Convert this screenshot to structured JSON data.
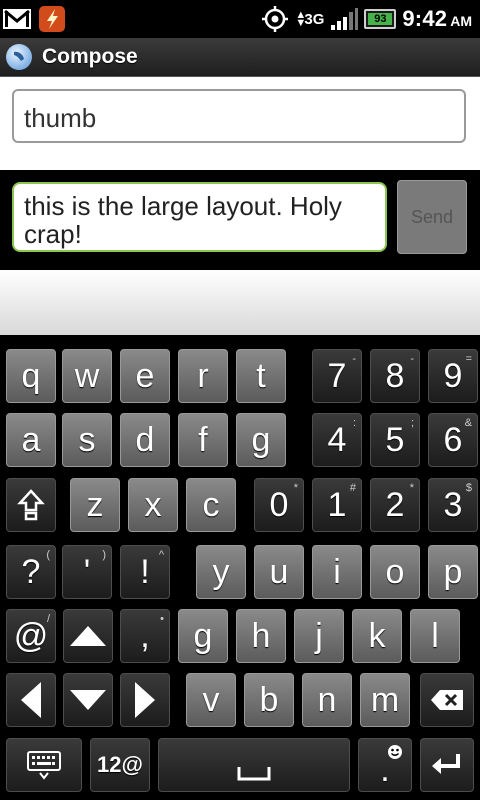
{
  "status_bar": {
    "icons": [
      "gmail-icon",
      "flash-icon",
      "gps-icon",
      "data-arrows-icon",
      "signal-icon",
      "battery-icon"
    ],
    "network": "3G",
    "battery": "93",
    "time": "9:42",
    "ampm": "AM"
  },
  "title_bar": {
    "title": "Compose"
  },
  "to_field": {
    "value": "thumb"
  },
  "message": {
    "value": "this is the large layout. Holy crap!",
    "send_label": "Send"
  },
  "keyboard": {
    "row1": [
      {
        "k": "q",
        "a": ""
      },
      {
        "k": "w",
        "a": ""
      },
      {
        "k": "e",
        "a": ""
      },
      {
        "k": "r",
        "a": ""
      },
      {
        "k": "t",
        "a": ""
      },
      {
        "k": "7",
        "a": "-"
      },
      {
        "k": "8",
        "a": "-"
      },
      {
        "k": "9",
        "a": "="
      }
    ],
    "row2": [
      {
        "k": "a",
        "a": ""
      },
      {
        "k": "s",
        "a": ""
      },
      {
        "k": "d",
        "a": ""
      },
      {
        "k": "f",
        "a": ""
      },
      {
        "k": "g",
        "a": ""
      },
      {
        "k": "4",
        "a": ":"
      },
      {
        "k": "5",
        "a": ";"
      },
      {
        "k": "6",
        "a": "&"
      }
    ],
    "row3": [
      {
        "k": "z",
        "a": ""
      },
      {
        "k": "x",
        "a": ""
      },
      {
        "k": "c",
        "a": ""
      },
      {
        "k": "0",
        "a": "*"
      },
      {
        "k": "1",
        "a": "#"
      },
      {
        "k": "2",
        "a": "*"
      },
      {
        "k": "3",
        "a": "$"
      }
    ],
    "row4": [
      {
        "k": "?",
        "a": "("
      },
      {
        "k": "'",
        "a": ")"
      },
      {
        "k": "!",
        "a": "^"
      },
      {
        "k": "y",
        "a": ""
      },
      {
        "k": "u",
        "a": ""
      },
      {
        "k": "i",
        "a": ""
      },
      {
        "k": "o",
        "a": ""
      },
      {
        "k": "p",
        "a": ""
      }
    ],
    "row5": [
      {
        "k": "@",
        "a": "/"
      },
      {
        "k": ",",
        "a": "•"
      },
      {
        "k": "g",
        "a": ""
      },
      {
        "k": "h",
        "a": ""
      },
      {
        "k": "j",
        "a": ""
      },
      {
        "k": "k",
        "a": ""
      },
      {
        "k": "l",
        "a": ""
      }
    ],
    "row6": [
      {
        "k": "v",
        "a": ""
      },
      {
        "k": "b",
        "a": ""
      },
      {
        "k": "n",
        "a": ""
      },
      {
        "k": "m",
        "a": ""
      }
    ],
    "mode_label": "12@",
    "period_key": "."
  }
}
